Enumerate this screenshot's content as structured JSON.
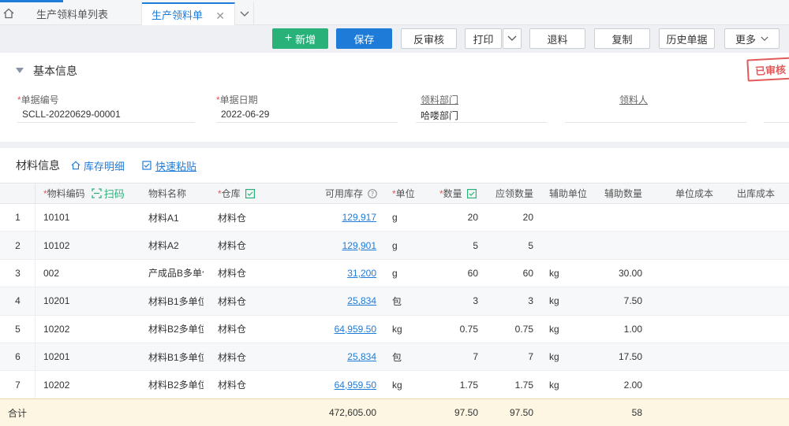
{
  "tabs": [
    {
      "label": "生产领料单列表"
    },
    {
      "label": "生产领料单"
    }
  ],
  "toolbar": {
    "new": "新增",
    "save": "保存",
    "unaudit": "反审核",
    "print": "打印",
    "return": "退料",
    "copy": "复制",
    "history": "历史单据",
    "more": "更多"
  },
  "stamp": "已审核",
  "basic": {
    "title": "基本信息",
    "fields": [
      {
        "label": "单据编号",
        "value": "SCLL-20220629-00001"
      },
      {
        "label": "单据日期",
        "value": "2022-06-29"
      },
      {
        "label": "领料部门",
        "value": "哈喽部门"
      },
      {
        "label": "领料人",
        "value": ""
      }
    ]
  },
  "materials": {
    "title": "材料信息",
    "stock_detail": "库存明细",
    "quick_paste": "快速粘贴",
    "headers": {
      "code": "物料编码",
      "scan": "扫码",
      "name": "物料名称",
      "warehouse": "仓库",
      "stock": "可用库存",
      "unit": "单位",
      "qty": "数量",
      "plan_qty": "应领数量",
      "aux_unit": "辅助单位",
      "aux_qty": "辅助数量",
      "unit_cost": "单位成本",
      "out_cost": "出库成本"
    },
    "rows": [
      {
        "idx": "1",
        "code": "10101",
        "name": "材料A1",
        "wh": "材料仓",
        "stock": "129,917",
        "unit": "g",
        "qty": "20",
        "plan": "20",
        "aux_unit": "",
        "aux_qty": ""
      },
      {
        "idx": "2",
        "code": "10102",
        "name": "材料A2",
        "wh": "材料仓",
        "stock": "129,901",
        "unit": "g",
        "qty": "5",
        "plan": "5",
        "aux_unit": "",
        "aux_qty": ""
      },
      {
        "idx": "3",
        "code": "002",
        "name": "产成品B多单位",
        "wh": "材料仓",
        "stock": "31,200",
        "unit": "g",
        "qty": "60",
        "plan": "60",
        "aux_unit": "kg",
        "aux_qty": "30.00"
      },
      {
        "idx": "4",
        "code": "10201",
        "name": "材料B1多单位I",
        "wh": "材料仓",
        "stock": "25,834",
        "unit": "包",
        "qty": "3",
        "plan": "3",
        "aux_unit": "kg",
        "aux_qty": "7.50"
      },
      {
        "idx": "5",
        "code": "10202",
        "name": "材料B2多单位I",
        "wh": "材料仓",
        "stock": "64,959.50",
        "unit": "kg",
        "qty": "0.75",
        "plan": "0.75",
        "aux_unit": "kg",
        "aux_qty": "1.00"
      },
      {
        "idx": "6",
        "code": "10201",
        "name": "材料B1多单位I",
        "wh": "材料仓",
        "stock": "25,834",
        "unit": "包",
        "qty": "7",
        "plan": "7",
        "aux_unit": "kg",
        "aux_qty": "17.50"
      },
      {
        "idx": "7",
        "code": "10202",
        "name": "材料B2多单位I",
        "wh": "材料仓",
        "stock": "64,959.50",
        "unit": "kg",
        "qty": "1.75",
        "plan": "1.75",
        "aux_unit": "kg",
        "aux_qty": "2.00"
      }
    ],
    "total": {
      "label": "合计",
      "stock": "472,605.00",
      "qty": "97.50",
      "plan": "97.50",
      "aux_qty": "58"
    }
  }
}
